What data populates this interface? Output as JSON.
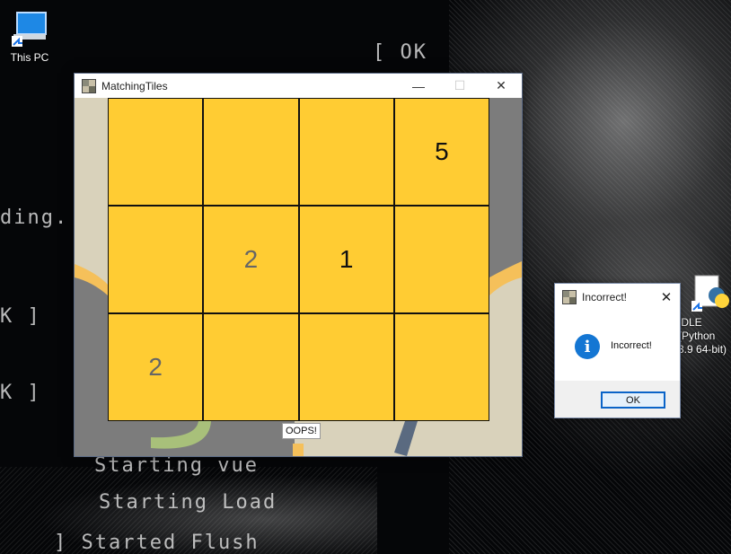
{
  "desktop": {
    "icons": [
      {
        "name": "this-pc",
        "label": "This PC"
      },
      {
        "name": "idle-python",
        "label": "IDLE (Python 3.9 64-bit)"
      }
    ],
    "bg_lines": [
      "[ OK",
      "ding.",
      "K ]",
      "K ]",
      "Starting vue",
      "Starting Load",
      "] Started Flush"
    ]
  },
  "window": {
    "title": "MatchingTiles",
    "controls": {
      "minimize": "—",
      "maximize": "☐",
      "close": "✕"
    },
    "tiles": [
      {
        "value": ""
      },
      {
        "value": ""
      },
      {
        "value": ""
      },
      {
        "value": "5",
        "style": "normal"
      },
      {
        "value": ""
      },
      {
        "value": "2",
        "style": "dim"
      },
      {
        "value": "1",
        "style": "normal"
      },
      {
        "value": ""
      },
      {
        "value": "2",
        "style": "dim"
      },
      {
        "value": ""
      },
      {
        "value": ""
      },
      {
        "value": ""
      }
    ],
    "status_label": "OOPS!"
  },
  "dialog": {
    "title": "Incorrect!",
    "close": "✕",
    "message": "Incorrect!",
    "icon": "info-icon",
    "ok_label": "OK"
  },
  "colors": {
    "tile": "#ffcc33",
    "grid_line": "#111111",
    "dialog_accent": "#1476d3"
  }
}
